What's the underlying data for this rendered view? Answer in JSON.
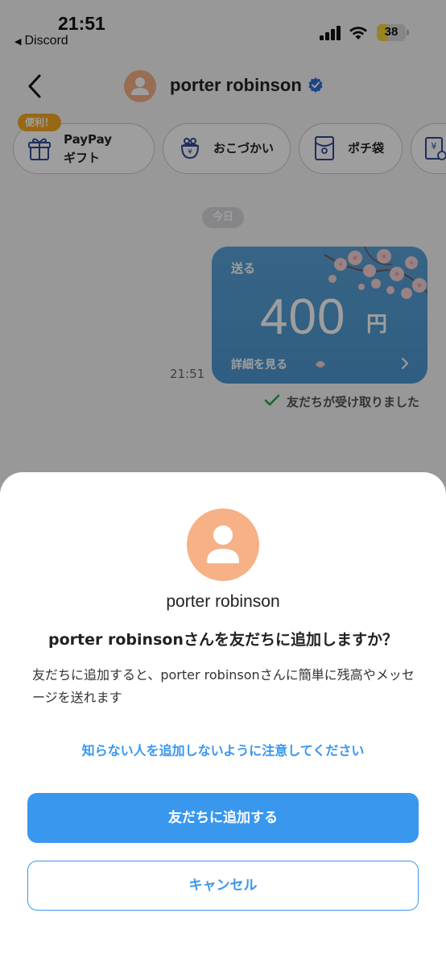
{
  "status_bar": {
    "time": "21:51",
    "back_app": "Discord",
    "battery": "38",
    "battery_level": 0.38
  },
  "header": {
    "name": "porter robinson"
  },
  "pills": {
    "badge": "便利！",
    "items": [
      {
        "label_line1": "PayPay",
        "label_line2": "ギフト",
        "icon": "gift-icon"
      },
      {
        "label": "おこづかい",
        "icon": "coin-purse-icon"
      },
      {
        "label": "ポチ袋",
        "icon": "envelope-icon"
      },
      {
        "icon": "yen-receipt-icon"
      }
    ]
  },
  "chat": {
    "date": "今日",
    "card": {
      "label": "送る",
      "amount": "400",
      "unit": "円",
      "detail": "詳細を見る"
    },
    "time": "21:51",
    "received": "友だちが受け取りました"
  },
  "sheet": {
    "name": "porter robinson",
    "question": "porter robinsonさんを友だちに追加しますか？",
    "desc": "友だちに追加すると、porter robinsonさんに簡単に残高やメッセージを送れます",
    "warning": "知らない人を追加しないように注意してください",
    "primary_button": "友だちに追加する",
    "secondary_button": "キャンセル"
  },
  "colors": {
    "accent": "#3a97ee",
    "badge": "#f4a825",
    "avatar": "#f6b186",
    "card": "#4d97d1"
  }
}
